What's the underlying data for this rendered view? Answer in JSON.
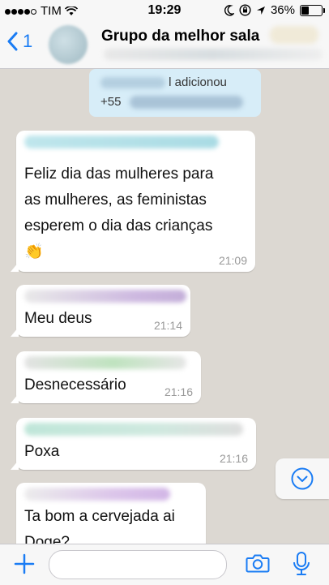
{
  "status_bar": {
    "carrier": "TIM",
    "time": "19:29",
    "battery": "36%",
    "signal_bars": 4
  },
  "header": {
    "back_count": "1",
    "title": "Grupo da melhor sala"
  },
  "system_message": {
    "line1_suffix": "l adicionou",
    "line2_prefix": "+55"
  },
  "messages": [
    {
      "lines": [
        "Feliz dia das mulheres para",
        "as mulheres, as feministas",
        "esperem o dia das crianças"
      ],
      "emoji": "👏",
      "time": "21:09"
    },
    {
      "lines": [
        "Meu deus"
      ],
      "time": "21:14"
    },
    {
      "lines": [
        "Desnecessário"
      ],
      "time": "21:16"
    },
    {
      "lines": [
        "Poxa"
      ],
      "time": "21:16"
    },
    {
      "lines": [
        "Ta bom a cervejada ai",
        "Doge?"
      ]
    }
  ],
  "colors": {
    "accent": "#1a7cf4",
    "chat_background": "#dcd8d2",
    "system_bubble": "#d7edf8",
    "bubble": "#ffffff"
  },
  "icons": {
    "back": "chevron-left-icon",
    "scroll": "chevron-down-icon",
    "attach": "plus-icon",
    "camera": "camera-icon",
    "mic": "microphone-icon"
  }
}
